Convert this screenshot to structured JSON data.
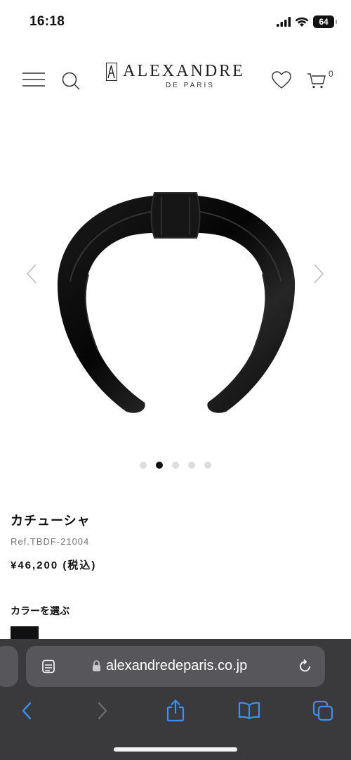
{
  "status": {
    "time": "16:18",
    "battery": "64"
  },
  "header": {
    "logo_name": "ALEXANDRE",
    "logo_sub": "DE PARIS",
    "cart_count": "0",
    "icons": [
      "menu-icon",
      "search-icon",
      "heart-icon",
      "cart-icon"
    ]
  },
  "carousel": {
    "image_subject": "black satin knot headband",
    "dot_count": 5,
    "active_index": 1
  },
  "product": {
    "name": "カチューシャ",
    "ref": "Ref.TBDF-21004",
    "price": "¥46,200 (税込)",
    "color_label": "カラーを選ぶ",
    "swatch_color": "#111111"
  },
  "browser": {
    "url": "alexandredeparis.co.jp",
    "accent": "#3e8ff3",
    "bar_bg": "#3a3a3c",
    "field_bg": "#57575b"
  }
}
